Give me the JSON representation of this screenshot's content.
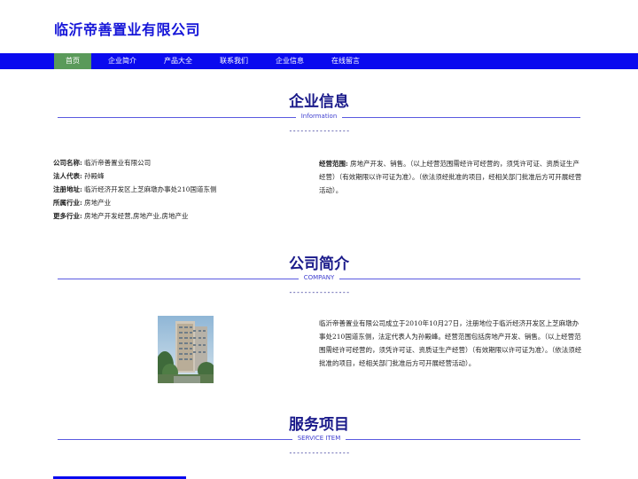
{
  "header": {
    "site_title": "临沂帝善置业有限公司"
  },
  "nav": {
    "items": [
      {
        "label": "首页",
        "active": true
      },
      {
        "label": "企业简介"
      },
      {
        "label": "产品大全"
      },
      {
        "label": "联系我们"
      },
      {
        "label": "企业信息"
      },
      {
        "label": "在线留言"
      }
    ]
  },
  "sections": {
    "info": {
      "title": "企业信息",
      "subtitle": "Information",
      "dash": "----------------"
    },
    "company": {
      "title": "公司简介",
      "subtitle": "COMPANY",
      "dash": "----------------"
    },
    "service": {
      "title": "服务项目",
      "subtitle": "SERVICE ITEM",
      "dash": "----------------"
    }
  },
  "company_info": {
    "name_label": "公司名称:",
    "name_value": "临沂帝善置业有限公司",
    "rep_label": "法人代表:",
    "rep_value": "孙殿峰",
    "addr_label": "注册地址:",
    "addr_value": "临沂经济开发区上芝麻墩办事处210国道东侧",
    "industry_label": "所属行业:",
    "industry_value": "房地产业",
    "more_label": "更多行业:",
    "more_value": "房地产开发经营,房地产业,房地产业",
    "scope_label": "经营范围:",
    "scope_value": "房地产开发、销售。（以上经营范围需经许可经营的，须凭许可证、资质证生产经营）（有效期限以许可证为准）。（依法须经批准的项目，经相关部门批准后方可开展经营活动）。"
  },
  "intro": {
    "photo": "building-photo",
    "text": "临沂帝善置业有限公司成立于2010年10月27日，注册地位于临沂经济开发区上芝麻墩办事处210国道东侧，法定代表人为孙殿峰。经营范围包括房地产开发、销售。（以上经营范围需经许可经营的，须凭许可证、资质证生产经营）（有效期限以许可证为准）。（依法须经批准的项目，经相关部门批准后方可开展经营活动）。"
  },
  "colors": {
    "nav_bg": "#0a0aef",
    "title_blue": "#1515d8",
    "active_tab": "#5a9a5a"
  }
}
